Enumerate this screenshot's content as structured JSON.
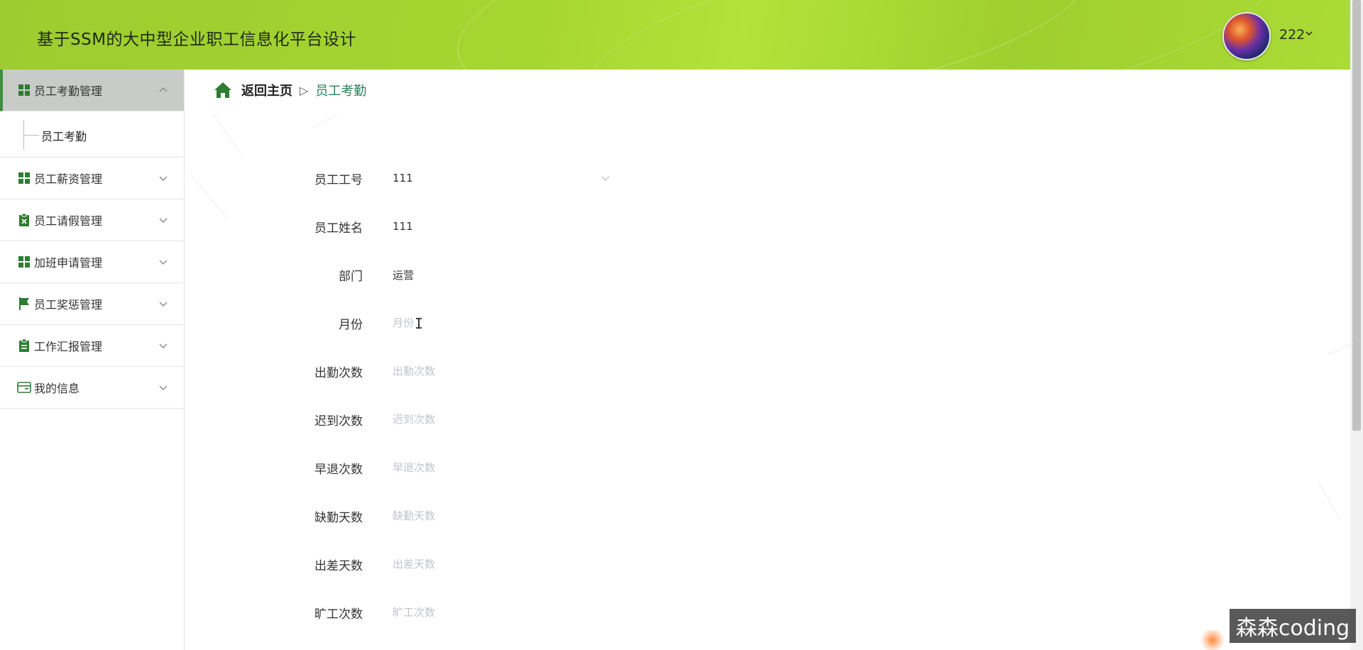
{
  "header": {
    "title": "基于SSM的大中型企业职工信息化平台设计",
    "user_name": "222"
  },
  "sidebar": {
    "items": [
      {
        "label": "员工考勤管理",
        "icon": "grid-icon",
        "expanded": true,
        "children": [
          {
            "label": "员工考勤"
          }
        ]
      },
      {
        "label": "员工薪资管理",
        "icon": "grid-icon",
        "expanded": false
      },
      {
        "label": "员工请假管理",
        "icon": "clipboard-x-icon",
        "expanded": false
      },
      {
        "label": "加班申请管理",
        "icon": "grid-icon",
        "expanded": false
      },
      {
        "label": "员工奖惩管理",
        "icon": "flag-icon",
        "expanded": false
      },
      {
        "label": "工作汇报管理",
        "icon": "clipboard-icon",
        "expanded": false
      },
      {
        "label": "我的信息",
        "icon": "card-icon",
        "expanded": false
      }
    ]
  },
  "breadcrumb": {
    "home": "返回主页",
    "separator": "▷",
    "current": "员工考勤"
  },
  "form": {
    "fields": [
      {
        "label": "员工工号",
        "value": "111",
        "placeholder": "",
        "type": "select"
      },
      {
        "label": "员工姓名",
        "value": "111",
        "placeholder": ""
      },
      {
        "label": "部门",
        "value": "运营",
        "placeholder": ""
      },
      {
        "label": "月份",
        "value": "",
        "placeholder": "月份"
      },
      {
        "label": "出勤次数",
        "value": "",
        "placeholder": "出勤次数"
      },
      {
        "label": "迟到次数",
        "value": "",
        "placeholder": "迟到次数"
      },
      {
        "label": "早退次数",
        "value": "",
        "placeholder": "早退次数"
      },
      {
        "label": "缺勤天数",
        "value": "",
        "placeholder": "缺勤天数"
      },
      {
        "label": "出差天数",
        "value": "",
        "placeholder": "出差天数"
      },
      {
        "label": "旷工次数",
        "value": "",
        "placeholder": "旷工次数"
      }
    ]
  },
  "watermark": "森森coding",
  "colors": {
    "header_green": "#a6d630",
    "icon_green": "#2f7d32",
    "active_bg": "#c9cbc9",
    "breadcrumb_current": "#2e7d5b"
  }
}
